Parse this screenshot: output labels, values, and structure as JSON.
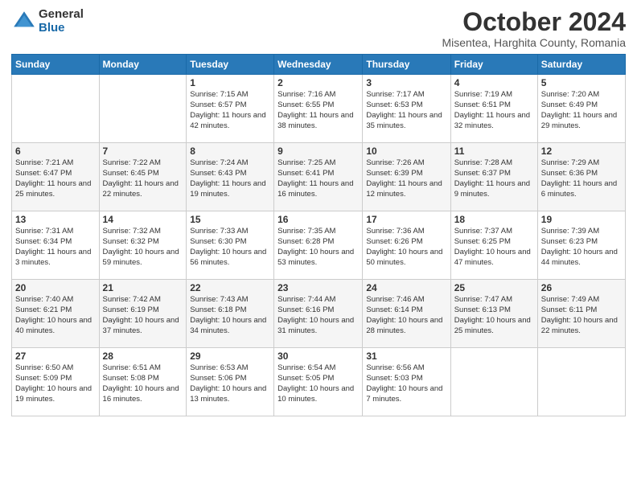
{
  "logo": {
    "general": "General",
    "blue": "Blue"
  },
  "header": {
    "title": "October 2024",
    "subtitle": "Misentea, Harghita County, Romania"
  },
  "weekdays": [
    "Sunday",
    "Monday",
    "Tuesday",
    "Wednesday",
    "Thursday",
    "Friday",
    "Saturday"
  ],
  "weeks": [
    [
      {
        "day": "",
        "sunrise": "",
        "sunset": "",
        "daylight": ""
      },
      {
        "day": "",
        "sunrise": "",
        "sunset": "",
        "daylight": ""
      },
      {
        "day": "1",
        "sunrise": "Sunrise: 7:15 AM",
        "sunset": "Sunset: 6:57 PM",
        "daylight": "Daylight: 11 hours and 42 minutes."
      },
      {
        "day": "2",
        "sunrise": "Sunrise: 7:16 AM",
        "sunset": "Sunset: 6:55 PM",
        "daylight": "Daylight: 11 hours and 38 minutes."
      },
      {
        "day": "3",
        "sunrise": "Sunrise: 7:17 AM",
        "sunset": "Sunset: 6:53 PM",
        "daylight": "Daylight: 11 hours and 35 minutes."
      },
      {
        "day": "4",
        "sunrise": "Sunrise: 7:19 AM",
        "sunset": "Sunset: 6:51 PM",
        "daylight": "Daylight: 11 hours and 32 minutes."
      },
      {
        "day": "5",
        "sunrise": "Sunrise: 7:20 AM",
        "sunset": "Sunset: 6:49 PM",
        "daylight": "Daylight: 11 hours and 29 minutes."
      }
    ],
    [
      {
        "day": "6",
        "sunrise": "Sunrise: 7:21 AM",
        "sunset": "Sunset: 6:47 PM",
        "daylight": "Daylight: 11 hours and 25 minutes."
      },
      {
        "day": "7",
        "sunrise": "Sunrise: 7:22 AM",
        "sunset": "Sunset: 6:45 PM",
        "daylight": "Daylight: 11 hours and 22 minutes."
      },
      {
        "day": "8",
        "sunrise": "Sunrise: 7:24 AM",
        "sunset": "Sunset: 6:43 PM",
        "daylight": "Daylight: 11 hours and 19 minutes."
      },
      {
        "day": "9",
        "sunrise": "Sunrise: 7:25 AM",
        "sunset": "Sunset: 6:41 PM",
        "daylight": "Daylight: 11 hours and 16 minutes."
      },
      {
        "day": "10",
        "sunrise": "Sunrise: 7:26 AM",
        "sunset": "Sunset: 6:39 PM",
        "daylight": "Daylight: 11 hours and 12 minutes."
      },
      {
        "day": "11",
        "sunrise": "Sunrise: 7:28 AM",
        "sunset": "Sunset: 6:37 PM",
        "daylight": "Daylight: 11 hours and 9 minutes."
      },
      {
        "day": "12",
        "sunrise": "Sunrise: 7:29 AM",
        "sunset": "Sunset: 6:36 PM",
        "daylight": "Daylight: 11 hours and 6 minutes."
      }
    ],
    [
      {
        "day": "13",
        "sunrise": "Sunrise: 7:31 AM",
        "sunset": "Sunset: 6:34 PM",
        "daylight": "Daylight: 11 hours and 3 minutes."
      },
      {
        "day": "14",
        "sunrise": "Sunrise: 7:32 AM",
        "sunset": "Sunset: 6:32 PM",
        "daylight": "Daylight: 10 hours and 59 minutes."
      },
      {
        "day": "15",
        "sunrise": "Sunrise: 7:33 AM",
        "sunset": "Sunset: 6:30 PM",
        "daylight": "Daylight: 10 hours and 56 minutes."
      },
      {
        "day": "16",
        "sunrise": "Sunrise: 7:35 AM",
        "sunset": "Sunset: 6:28 PM",
        "daylight": "Daylight: 10 hours and 53 minutes."
      },
      {
        "day": "17",
        "sunrise": "Sunrise: 7:36 AM",
        "sunset": "Sunset: 6:26 PM",
        "daylight": "Daylight: 10 hours and 50 minutes."
      },
      {
        "day": "18",
        "sunrise": "Sunrise: 7:37 AM",
        "sunset": "Sunset: 6:25 PM",
        "daylight": "Daylight: 10 hours and 47 minutes."
      },
      {
        "day": "19",
        "sunrise": "Sunrise: 7:39 AM",
        "sunset": "Sunset: 6:23 PM",
        "daylight": "Daylight: 10 hours and 44 minutes."
      }
    ],
    [
      {
        "day": "20",
        "sunrise": "Sunrise: 7:40 AM",
        "sunset": "Sunset: 6:21 PM",
        "daylight": "Daylight: 10 hours and 40 minutes."
      },
      {
        "day": "21",
        "sunrise": "Sunrise: 7:42 AM",
        "sunset": "Sunset: 6:19 PM",
        "daylight": "Daylight: 10 hours and 37 minutes."
      },
      {
        "day": "22",
        "sunrise": "Sunrise: 7:43 AM",
        "sunset": "Sunset: 6:18 PM",
        "daylight": "Daylight: 10 hours and 34 minutes."
      },
      {
        "day": "23",
        "sunrise": "Sunrise: 7:44 AM",
        "sunset": "Sunset: 6:16 PM",
        "daylight": "Daylight: 10 hours and 31 minutes."
      },
      {
        "day": "24",
        "sunrise": "Sunrise: 7:46 AM",
        "sunset": "Sunset: 6:14 PM",
        "daylight": "Daylight: 10 hours and 28 minutes."
      },
      {
        "day": "25",
        "sunrise": "Sunrise: 7:47 AM",
        "sunset": "Sunset: 6:13 PM",
        "daylight": "Daylight: 10 hours and 25 minutes."
      },
      {
        "day": "26",
        "sunrise": "Sunrise: 7:49 AM",
        "sunset": "Sunset: 6:11 PM",
        "daylight": "Daylight: 10 hours and 22 minutes."
      }
    ],
    [
      {
        "day": "27",
        "sunrise": "Sunrise: 6:50 AM",
        "sunset": "Sunset: 5:09 PM",
        "daylight": "Daylight: 10 hours and 19 minutes."
      },
      {
        "day": "28",
        "sunrise": "Sunrise: 6:51 AM",
        "sunset": "Sunset: 5:08 PM",
        "daylight": "Daylight: 10 hours and 16 minutes."
      },
      {
        "day": "29",
        "sunrise": "Sunrise: 6:53 AM",
        "sunset": "Sunset: 5:06 PM",
        "daylight": "Daylight: 10 hours and 13 minutes."
      },
      {
        "day": "30",
        "sunrise": "Sunrise: 6:54 AM",
        "sunset": "Sunset: 5:05 PM",
        "daylight": "Daylight: 10 hours and 10 minutes."
      },
      {
        "day": "31",
        "sunrise": "Sunrise: 6:56 AM",
        "sunset": "Sunset: 5:03 PM",
        "daylight": "Daylight: 10 hours and 7 minutes."
      },
      {
        "day": "",
        "sunrise": "",
        "sunset": "",
        "daylight": ""
      },
      {
        "day": "",
        "sunrise": "",
        "sunset": "",
        "daylight": ""
      }
    ]
  ]
}
